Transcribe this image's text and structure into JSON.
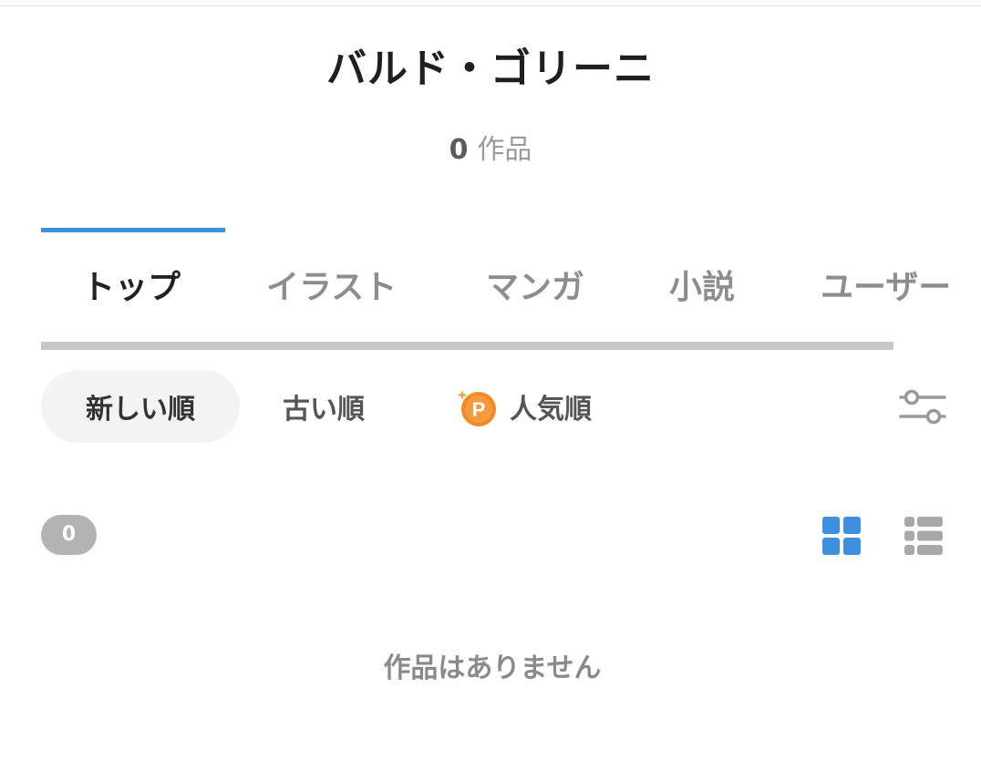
{
  "profile": {
    "name": "バルド・ゴリーニ",
    "works_count": "0",
    "works_label": "作品"
  },
  "tabs": [
    {
      "label": "トップ",
      "active": true
    },
    {
      "label": "イラスト",
      "active": false
    },
    {
      "label": "マンガ",
      "active": false
    },
    {
      "label": "小説",
      "active": false
    },
    {
      "label": "ユーザー",
      "active": false
    }
  ],
  "sort": {
    "newest": "新しい順",
    "oldest": "古い順",
    "popular": "人気順",
    "premium_badge": "P"
  },
  "results": {
    "count": "0",
    "empty_message": "作品はありません"
  },
  "colors": {
    "accent": "#3d8fe0",
    "premium": "#f08a24",
    "inactive": "#8d8d8d"
  }
}
